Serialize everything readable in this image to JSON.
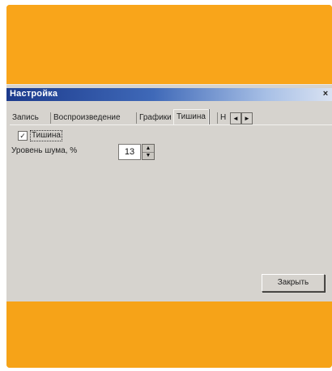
{
  "dialog": {
    "title": "Настройка",
    "close_symbol": "×"
  },
  "tabs": [
    {
      "label": "Запись"
    },
    {
      "label": "Воспроизведение"
    },
    {
      "label": "Графики"
    },
    {
      "label": "Тишина",
      "active": true
    }
  ],
  "tab_scroll": {
    "left": "◄",
    "right": "►",
    "partial": "Н"
  },
  "silence": {
    "checkbox_label": "Тишина",
    "checked": true,
    "check_mark": "✓",
    "noise_label": "Уровень шума, %",
    "noise_value": "13",
    "spin_up": "▲",
    "spin_down": "▼"
  },
  "footer": {
    "close_label": "Закрыть"
  },
  "colors": {
    "background_orange": "#f7a619",
    "dialog_gray": "#d6d3ce",
    "titlebar_blue": "#1c3a8c"
  },
  "icons": [
    "close-icon",
    "check-icon",
    "arrow-left-icon",
    "arrow-right-icon",
    "spin-up-icon",
    "spin-down-icon"
  ]
}
